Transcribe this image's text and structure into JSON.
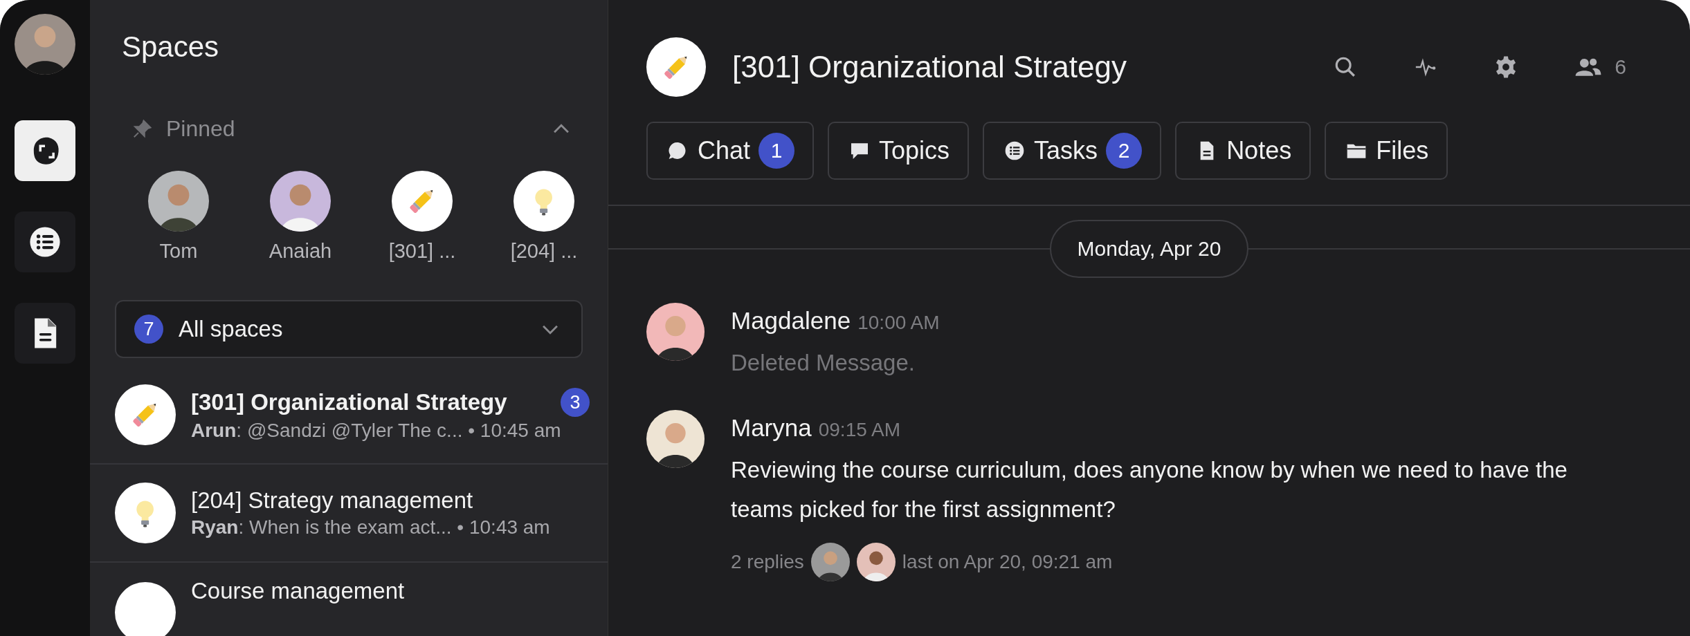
{
  "rail": {
    "items": [
      {
        "kind": "spaces",
        "selected": true
      },
      {
        "kind": "list",
        "selected": false
      },
      {
        "kind": "document",
        "selected": false
      }
    ]
  },
  "sidebar": {
    "title": "Spaces",
    "pinned": {
      "label": "Pinned",
      "expanded": true,
      "items": [
        {
          "label": "Tom",
          "kind": "person"
        },
        {
          "label": "Anaiah",
          "kind": "person"
        },
        {
          "label": "[301] ...",
          "kind": "pencil"
        },
        {
          "label": "[204] ...",
          "kind": "bulb"
        }
      ]
    },
    "filter": {
      "count": "7",
      "label": "All spaces"
    },
    "spaces": [
      {
        "kind": "pencil",
        "title": "[301] Organizational Strategy",
        "unread": true,
        "badge": "3",
        "preview": "**Arun**: @Sandzi @Tyler The c... • 10:45 am"
      },
      {
        "kind": "bulb",
        "title": "[204] Strategy management",
        "unread": false,
        "preview": "**Ryan**: When is the exam act... • 10:43 am"
      },
      {
        "title": "Course management",
        "unread": false
      }
    ]
  },
  "main": {
    "title": "[301] Organizational Strategy",
    "members": "6",
    "tabs": [
      {
        "kind": "chat",
        "label": "Chat",
        "badge": "1"
      },
      {
        "kind": "topics",
        "label": "Topics"
      },
      {
        "kind": "tasks",
        "label": "Tasks",
        "badge": "2"
      },
      {
        "kind": "notes",
        "label": "Notes"
      },
      {
        "kind": "files",
        "label": "Files"
      }
    ],
    "date": "Monday, Apr 20",
    "messages": [
      {
        "author": "Magdalene",
        "time": "10:00 AM",
        "text": "Deleted Message.",
        "deleted": true
      },
      {
        "author": "Maryna",
        "time": "09:15 AM",
        "text": "Reviewing the course curriculum, does anyone know by when we need to have the teams picked for the first assignment?",
        "deleted": false,
        "replies": {
          "count": "2 replies",
          "last": "last on Apr 20, 09:21 am"
        }
      }
    ]
  }
}
